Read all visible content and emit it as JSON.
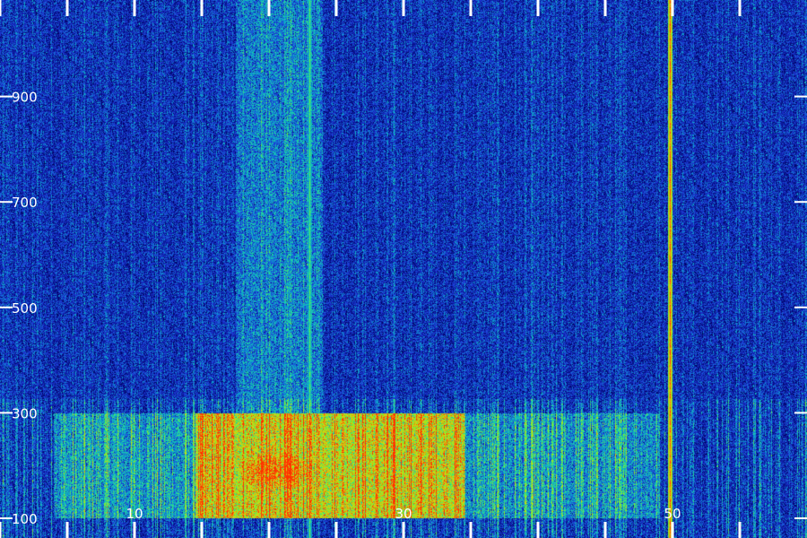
{
  "chart_data": {
    "type": "heatmap",
    "title": "",
    "xlabel": "",
    "ylabel": "",
    "x_range": [
      0,
      60
    ],
    "y_range": [
      100,
      1083
    ],
    "x_ticks": [
      0,
      5,
      10,
      15,
      20,
      25,
      30,
      35,
      40,
      45,
      50,
      55
    ],
    "x_tick_labels": [
      {
        "value": 10,
        "text": "10"
      },
      {
        "value": 30,
        "text": "30"
      },
      {
        "value": 50,
        "text": "50"
      }
    ],
    "y_ticks": [
      {
        "value": 100,
        "text": "100"
      },
      {
        "value": 300,
        "text": "300"
      },
      {
        "value": 500,
        "text": "500"
      },
      {
        "value": 700,
        "text": "700"
      },
      {
        "value": 900,
        "text": "900"
      }
    ],
    "colormap": [
      "#000060",
      "#0a1a9c",
      "#1f3cd8",
      "#0aa0d0",
      "#20d8a0",
      "#8cf020",
      "#e0d010",
      "#ff3000"
    ],
    "background_level": 0.22,
    "features": [
      {
        "kind": "band",
        "x": [
          14.5,
          34.5
        ],
        "y": [
          100,
          300
        ],
        "level": 0.78
      },
      {
        "kind": "band",
        "x": [
          4,
          14.5
        ],
        "y": [
          100,
          300
        ],
        "level": 0.42
      },
      {
        "kind": "band",
        "x": [
          34.5,
          49
        ],
        "y": [
          100,
          300
        ],
        "level": 0.4
      },
      {
        "kind": "band",
        "x": [
          17.5,
          24
        ],
        "y": [
          300,
          1083
        ],
        "level": 0.38
      },
      {
        "kind": "hotspot",
        "x": [
          16,
          25
        ],
        "y": [
          130,
          250
        ],
        "level": 0.92
      },
      {
        "kind": "line",
        "x": 49.8,
        "y": [
          100,
          1083
        ],
        "level": 0.95
      },
      {
        "kind": "line",
        "x": 23.0,
        "y": [
          100,
          1083
        ],
        "level": 0.62
      }
    ]
  }
}
